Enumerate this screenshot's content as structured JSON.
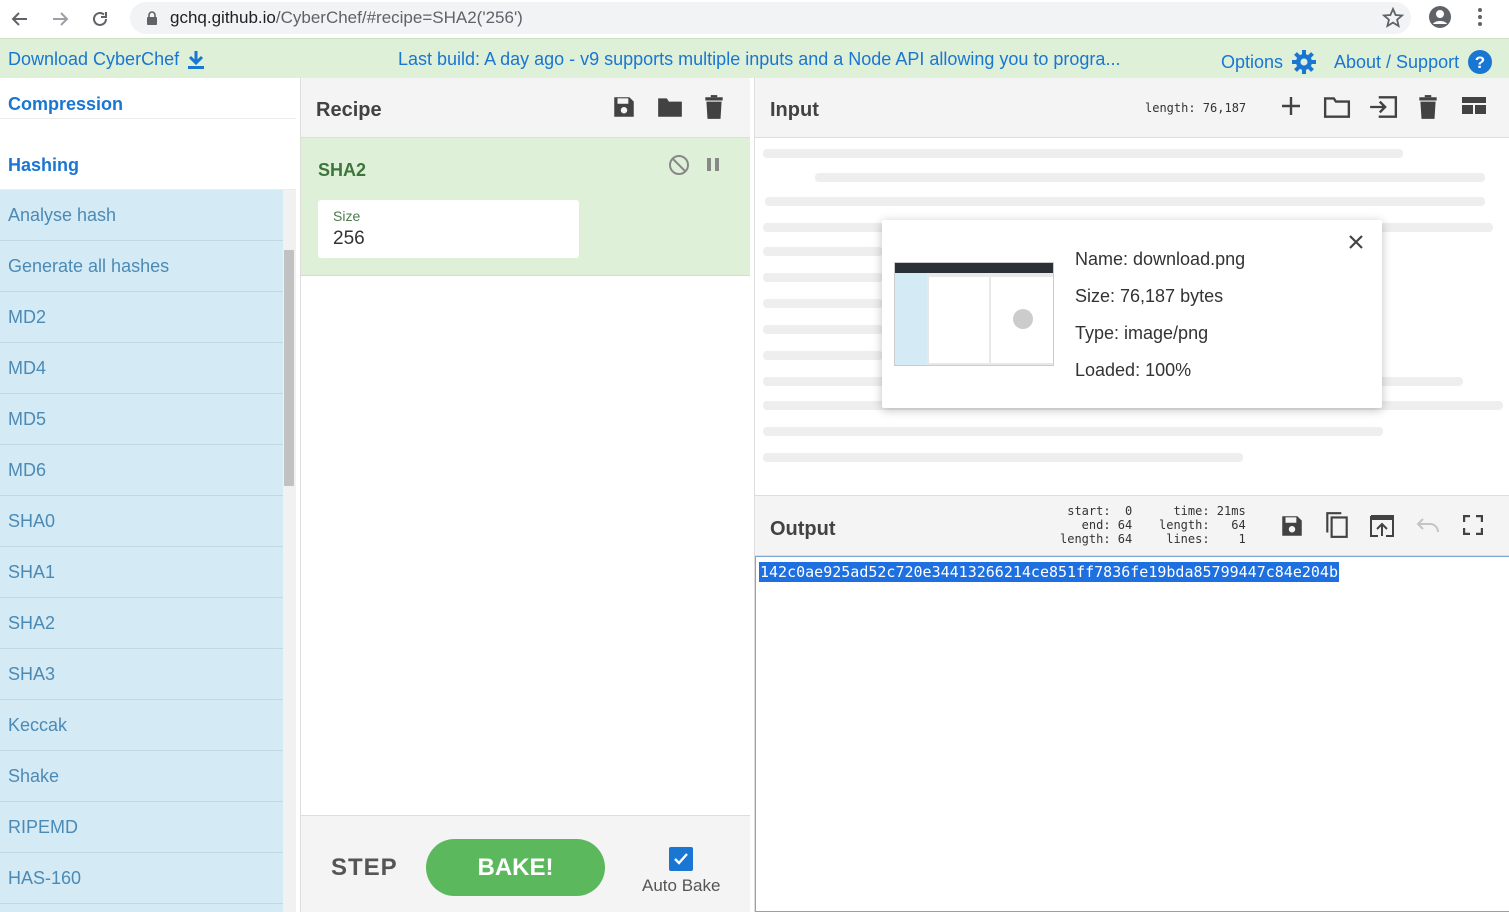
{
  "browser": {
    "url_domain": "gchq.github.io",
    "url_path": "/CyberChef/#recipe=SHA2('256')"
  },
  "banner": {
    "download_label": "Download CyberChef",
    "build_message": "Last build: A day ago - v9 supports multiple inputs and a Node API allowing you to progra...",
    "options_label": "Options",
    "about_label": "About / Support"
  },
  "sidebar": {
    "categories": [
      {
        "label": "Compression"
      },
      {
        "label": "Hashing"
      }
    ],
    "operations": [
      {
        "label": "Analyse hash"
      },
      {
        "label": "Generate all hashes"
      },
      {
        "label": "MD2"
      },
      {
        "label": "MD4"
      },
      {
        "label": "MD5"
      },
      {
        "label": "MD6"
      },
      {
        "label": "SHA0"
      },
      {
        "label": "SHA1"
      },
      {
        "label": "SHA2"
      },
      {
        "label": "SHA3"
      },
      {
        "label": "Keccak"
      },
      {
        "label": "Shake"
      },
      {
        "label": "RIPEMD"
      },
      {
        "label": "HAS-160"
      }
    ]
  },
  "recipe": {
    "title": "Recipe",
    "operation": {
      "name": "SHA2",
      "size_label": "Size",
      "size_value": "256"
    },
    "step_label": "STEP",
    "bake_label": "BAKE!",
    "autobake_label": "Auto Bake",
    "autobake_checked": true
  },
  "input": {
    "title": "Input",
    "length_text": "length: 76,187",
    "file": {
      "name": "Name: download.png",
      "size": "Size: 76,187 bytes",
      "type": "Type: image/png",
      "loaded": "Loaded: 100%"
    }
  },
  "output": {
    "title": "Output",
    "stats_left": "start:  0\n  end: 64\nlength: 64",
    "stats_right": " time: 21ms\nlength:   64\n lines:    1",
    "value": "142c0ae925ad52c720e34413266214ce851ff7836fe19bda85799447c84e204b"
  },
  "colors": {
    "banner_bg": "#dff0d8",
    "op_list_bg": "#d4eaf5",
    "link_blue": "#1976d2",
    "bake_green": "#5cb85c",
    "selection_blue": "#1e6fe0"
  }
}
